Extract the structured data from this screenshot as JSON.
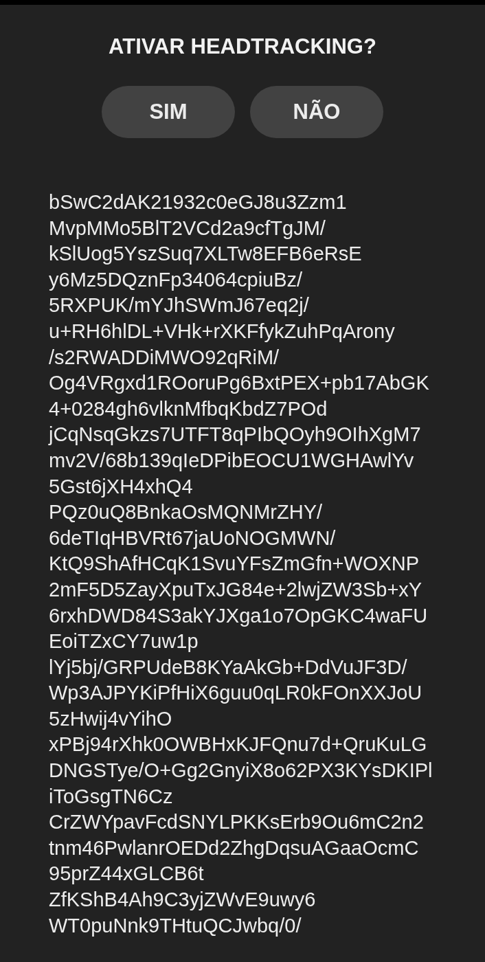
{
  "title": "ATIVAR HEADTRACKING?",
  "buttons": [
    {
      "label": "SIM"
    },
    {
      "label": "NÃO"
    }
  ],
  "encoded_text": [
    "bSwC2dAK21932c0eGJ8u3Zzm1",
    "MvpMMo5BlT2VCd2a9cfTgJM/",
    "kSlUog5YszSuq7XLTw8EFB6eRsE",
    "y6Mz5DQznFp34064cpiuBz/",
    "5RXPUK/mYJhSWmJ67eq2j/",
    "u+RH6hlDL+VHk+rXKFfykZuhPqArony",
    "/s2RWADDiMWO92qRiM/",
    "Og4VRgxd1ROoruPg6BxtPEX+pb17AbGK",
    "4+0284gh6vlknMfbqKbdZ7POd",
    "jCqNsqGkzs7UTFT8qPIbQOyh9OIhXgM7",
    "mv2V/68b139qIeDPibEOCU1WGHAwlYv",
    "5Gst6jXH4xhQ4",
    "PQz0uQ8BnkaOsMQNMrZHY/",
    "6deTIqHBVRt67jaUoNOGMWN/",
    "KtQ9ShAfHCqK1SvuYFsZmGfn+WOXNP",
    "2mF5D5ZayXpuTxJG84e+2lwjZW3Sb+xY",
    "6rxhDWD84S3akYJXga1o7OpGKC4waFU",
    "EoiTZxCY7uw1p",
    "lYj5bj/GRPUdeB8KYaAkGb+DdVuJF3D/",
    "Wp3AJPYKiPfHiX6guu0qLR0kFOnXXJoU",
    "5zHwij4vYihO",
    "xPBj94rXhk0OWBHxKJFQnu7d+QruKuLG",
    "DNGSTye/O+Gg2GnyiX8o62PX3KYsDKIPl",
    "iToGsgTN6Cz",
    "CrZWYpavFcdSNYLPKKsErb9Ou6mC2n2",
    "tnm46PwlanrOEDd2ZhgDqsuAGaaOcmC",
    "95prZ44xGLCB6t",
    "ZfKShB4Ah9C3yjZWvE9uwy6",
    "WT0puNnk9THtuQCJwbq/0/"
  ]
}
